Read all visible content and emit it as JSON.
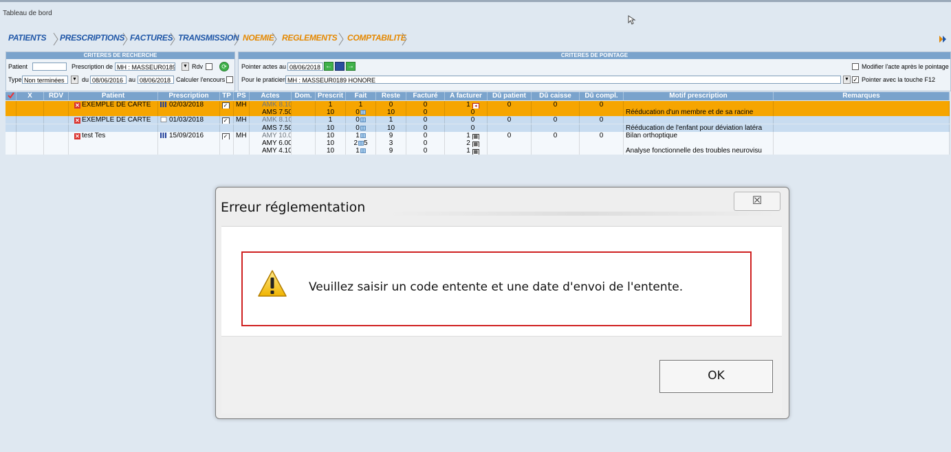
{
  "window": {
    "title": "Tableau de bord"
  },
  "nav": {
    "items": [
      "PATIENTS",
      "PRESCRIPTIONS",
      "FACTURES",
      "TRANSMISSION",
      "NOEMIE",
      "REGLEMENTS",
      "COMPTABILITE"
    ]
  },
  "search": {
    "title": "CRITERES DE RECHERCHE",
    "patient_label": "Patient",
    "patient_value": "",
    "prescription_label": "Prescription de",
    "prescription_value": "MH : MASSEUR0189 H",
    "rdv_label": "Rdv",
    "type_label": "Type",
    "type_value": "Non terminées",
    "du_label": "du",
    "du_value": "08/06/2016",
    "au_label": "au",
    "au_value": "08/06/2018",
    "encours_label": "Calculer l'encours"
  },
  "pointage": {
    "title": "CRITERES DE POINTAGE",
    "pointer_label": "Pointer actes au",
    "pointer_date": "08/06/2018",
    "praticien_label": "Pour le praticien",
    "praticien_value": "MH : MASSEUR0189 HONORE",
    "modifier_label": "Modifier l'acte après le pointage",
    "f12_label": "Pointer avec la touche F12"
  },
  "table": {
    "headers": [
      "X",
      "RDV",
      "Patient",
      "Prescription",
      "TP",
      "PS",
      "Actes",
      "Dom.",
      "Prescrit",
      "Fait",
      "Reste",
      "Facturé",
      "A facturer",
      "Dû patient",
      "Dû caisse",
      "Dû compl.",
      "Motif prescription",
      "Remarques"
    ],
    "rows": [
      {
        "patient": "EXEMPLE DE CARTE",
        "prescription": "02/03/2018",
        "ps": "MH",
        "acte": "AMK 8.10",
        "prescrit": "1",
        "fait": "1",
        "reste": "0",
        "facture": "0",
        "a_facturer": "1",
        "du_patient": "0",
        "du_caisse": "0",
        "du_compl": "0",
        "motif": ""
      },
      {
        "patient": "",
        "prescription": "",
        "ps": "",
        "acte": "AMS 7.50",
        "prescrit": "10",
        "fait": "0",
        "reste": "10",
        "facture": "0",
        "a_facturer": "0",
        "du_patient": "",
        "du_caisse": "",
        "du_compl": "",
        "motif": "Rééducation d'un membre et de sa racine"
      },
      {
        "patient": "EXEMPLE DE CARTE",
        "prescription": "01/03/2018",
        "ps": "MH",
        "acte": "AMK 8.10",
        "prescrit": "1",
        "fait": "0",
        "reste": "1",
        "facture": "0",
        "a_facturer": "0",
        "du_patient": "0",
        "du_caisse": "0",
        "du_compl": "0",
        "motif": ""
      },
      {
        "patient": "",
        "prescription": "",
        "ps": "",
        "acte": "AMS 7.50",
        "prescrit": "10",
        "fait": "0",
        "reste": "10",
        "facture": "0",
        "a_facturer": "0",
        "du_patient": "",
        "du_caisse": "",
        "du_compl": "",
        "motif": "Rééducation de l'enfant pour déviation latéra"
      },
      {
        "patient": "test Tes",
        "prescription": "15/09/2016",
        "ps": "MH",
        "acte": "AMY 10.0(",
        "prescrit": "10",
        "fait": "1",
        "reste": "9",
        "facture": "0",
        "a_facturer": "1",
        "du_patient": "0",
        "du_caisse": "0",
        "du_compl": "0",
        "motif": "Bilan orthoptique"
      },
      {
        "patient": "",
        "prescription": "",
        "ps": "",
        "acte": "AMY 6.00",
        "prescrit": "10",
        "fait": "2",
        "fait_extra": "5",
        "reste": "3",
        "facture": "0",
        "a_facturer": "2",
        "du_patient": "",
        "du_caisse": "",
        "du_compl": "",
        "motif": ""
      },
      {
        "patient": "",
        "prescription": "",
        "ps": "",
        "acte": "AMY 4.10",
        "prescrit": "10",
        "fait": "1",
        "reste": "9",
        "facture": "0",
        "a_facturer": "1",
        "du_patient": "",
        "du_caisse": "",
        "du_compl": "",
        "motif": "Analyse fonctionnelle des troubles neurovisu"
      }
    ]
  },
  "dialog": {
    "title": "Erreur réglementation",
    "close_glyph": "☒",
    "message": "Veuillez saisir un code entente et une date d'envoi de l'entente.",
    "ok_label": "OK"
  },
  "colors": {
    "orange_row": "#f6a500",
    "blue_row": "#c8dcf0",
    "header": "#7aa3cc",
    "error_frame": "#cf2020"
  }
}
